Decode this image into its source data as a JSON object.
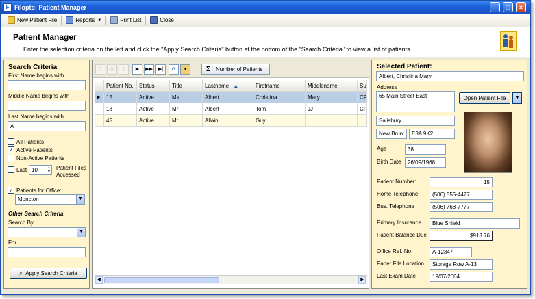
{
  "window": {
    "title": "Filopto: Patient Manager"
  },
  "toolbar": {
    "new_patient": "New Patient File",
    "reports": "Reports",
    "print_list": "Print List",
    "close": "Close"
  },
  "header": {
    "title": "Patient Manager",
    "instructions": "Enter the selection criteria on the left and click the \"Apply Search Criteria\" button at the bottom of the \"Search Criteria\" to view a list of patients."
  },
  "search": {
    "title": "Search Criteria",
    "first_name_label": "First Name begins with",
    "first_name_value": "",
    "middle_name_label": "Middle Name begins with",
    "middle_name_value": "",
    "last_name_label": "Last Name begins with",
    "last_name_value": "A",
    "all_patients": "All Patients",
    "active_patients": "Active Patients",
    "non_active_patients": "Non-Active Patients",
    "last_label": "Last",
    "last_value": "10",
    "files_accessed": "Patient Files Accessed",
    "patients_for_office": "Patients for Office:",
    "office_value": "Moncton",
    "other_title": "Other Search Criteria",
    "search_by_label": "Search By",
    "search_by_value": "",
    "for_label": "For",
    "for_value": "",
    "apply_button": "Apply Search Criteria"
  },
  "grid": {
    "number_of_patients": "Number of Patients",
    "columns": [
      "Patient No.",
      "Status",
      "Title",
      "Lastname",
      "Firstname",
      "Middlename",
      "Suff"
    ],
    "rows": [
      [
        "15",
        "Active",
        "Ms",
        "Albert",
        "Christina",
        "Mary",
        "CPA"
      ],
      [
        "18",
        "Active",
        "Mr",
        "Albert",
        "Tom",
        "JJ",
        "CPA"
      ],
      [
        "45",
        "Active",
        "Mr",
        "Allain",
        "Guy",
        "",
        ""
      ]
    ]
  },
  "selected": {
    "title": "Selected Patient:",
    "name": "Albert, Christina Mary",
    "address_label": "Address",
    "address_value": "65 Main Street East",
    "open_button": "Open Patient File",
    "city": "Salisbury",
    "province": "New Brun:",
    "postal": "E3A 9K2",
    "age_label": "Age",
    "age_value": "38",
    "birth_label": "Birth Date",
    "birth_value": "26/09/1968",
    "patient_number_label": "Patient Number:",
    "patient_number_value": "15",
    "home_tel_label": "Home Telephone",
    "home_tel_value": "(506) 555-4477",
    "bus_tel_label": "Bus. Telephone",
    "bus_tel_value": "(506) 768-7777",
    "insurance_label": "Primary Insurance",
    "insurance_value": "Blue Shield",
    "balance_label": "Patient Balance Due",
    "balance_value": "$913.76",
    "office_ref_label": "Office Ref. No",
    "office_ref_value": "A-12347",
    "file_location_label": "Paper File Location",
    "file_location_value": "Storage Row A-13",
    "last_exam_label": "Last Exam Date",
    "last_exam_value": "19/07/2004"
  }
}
